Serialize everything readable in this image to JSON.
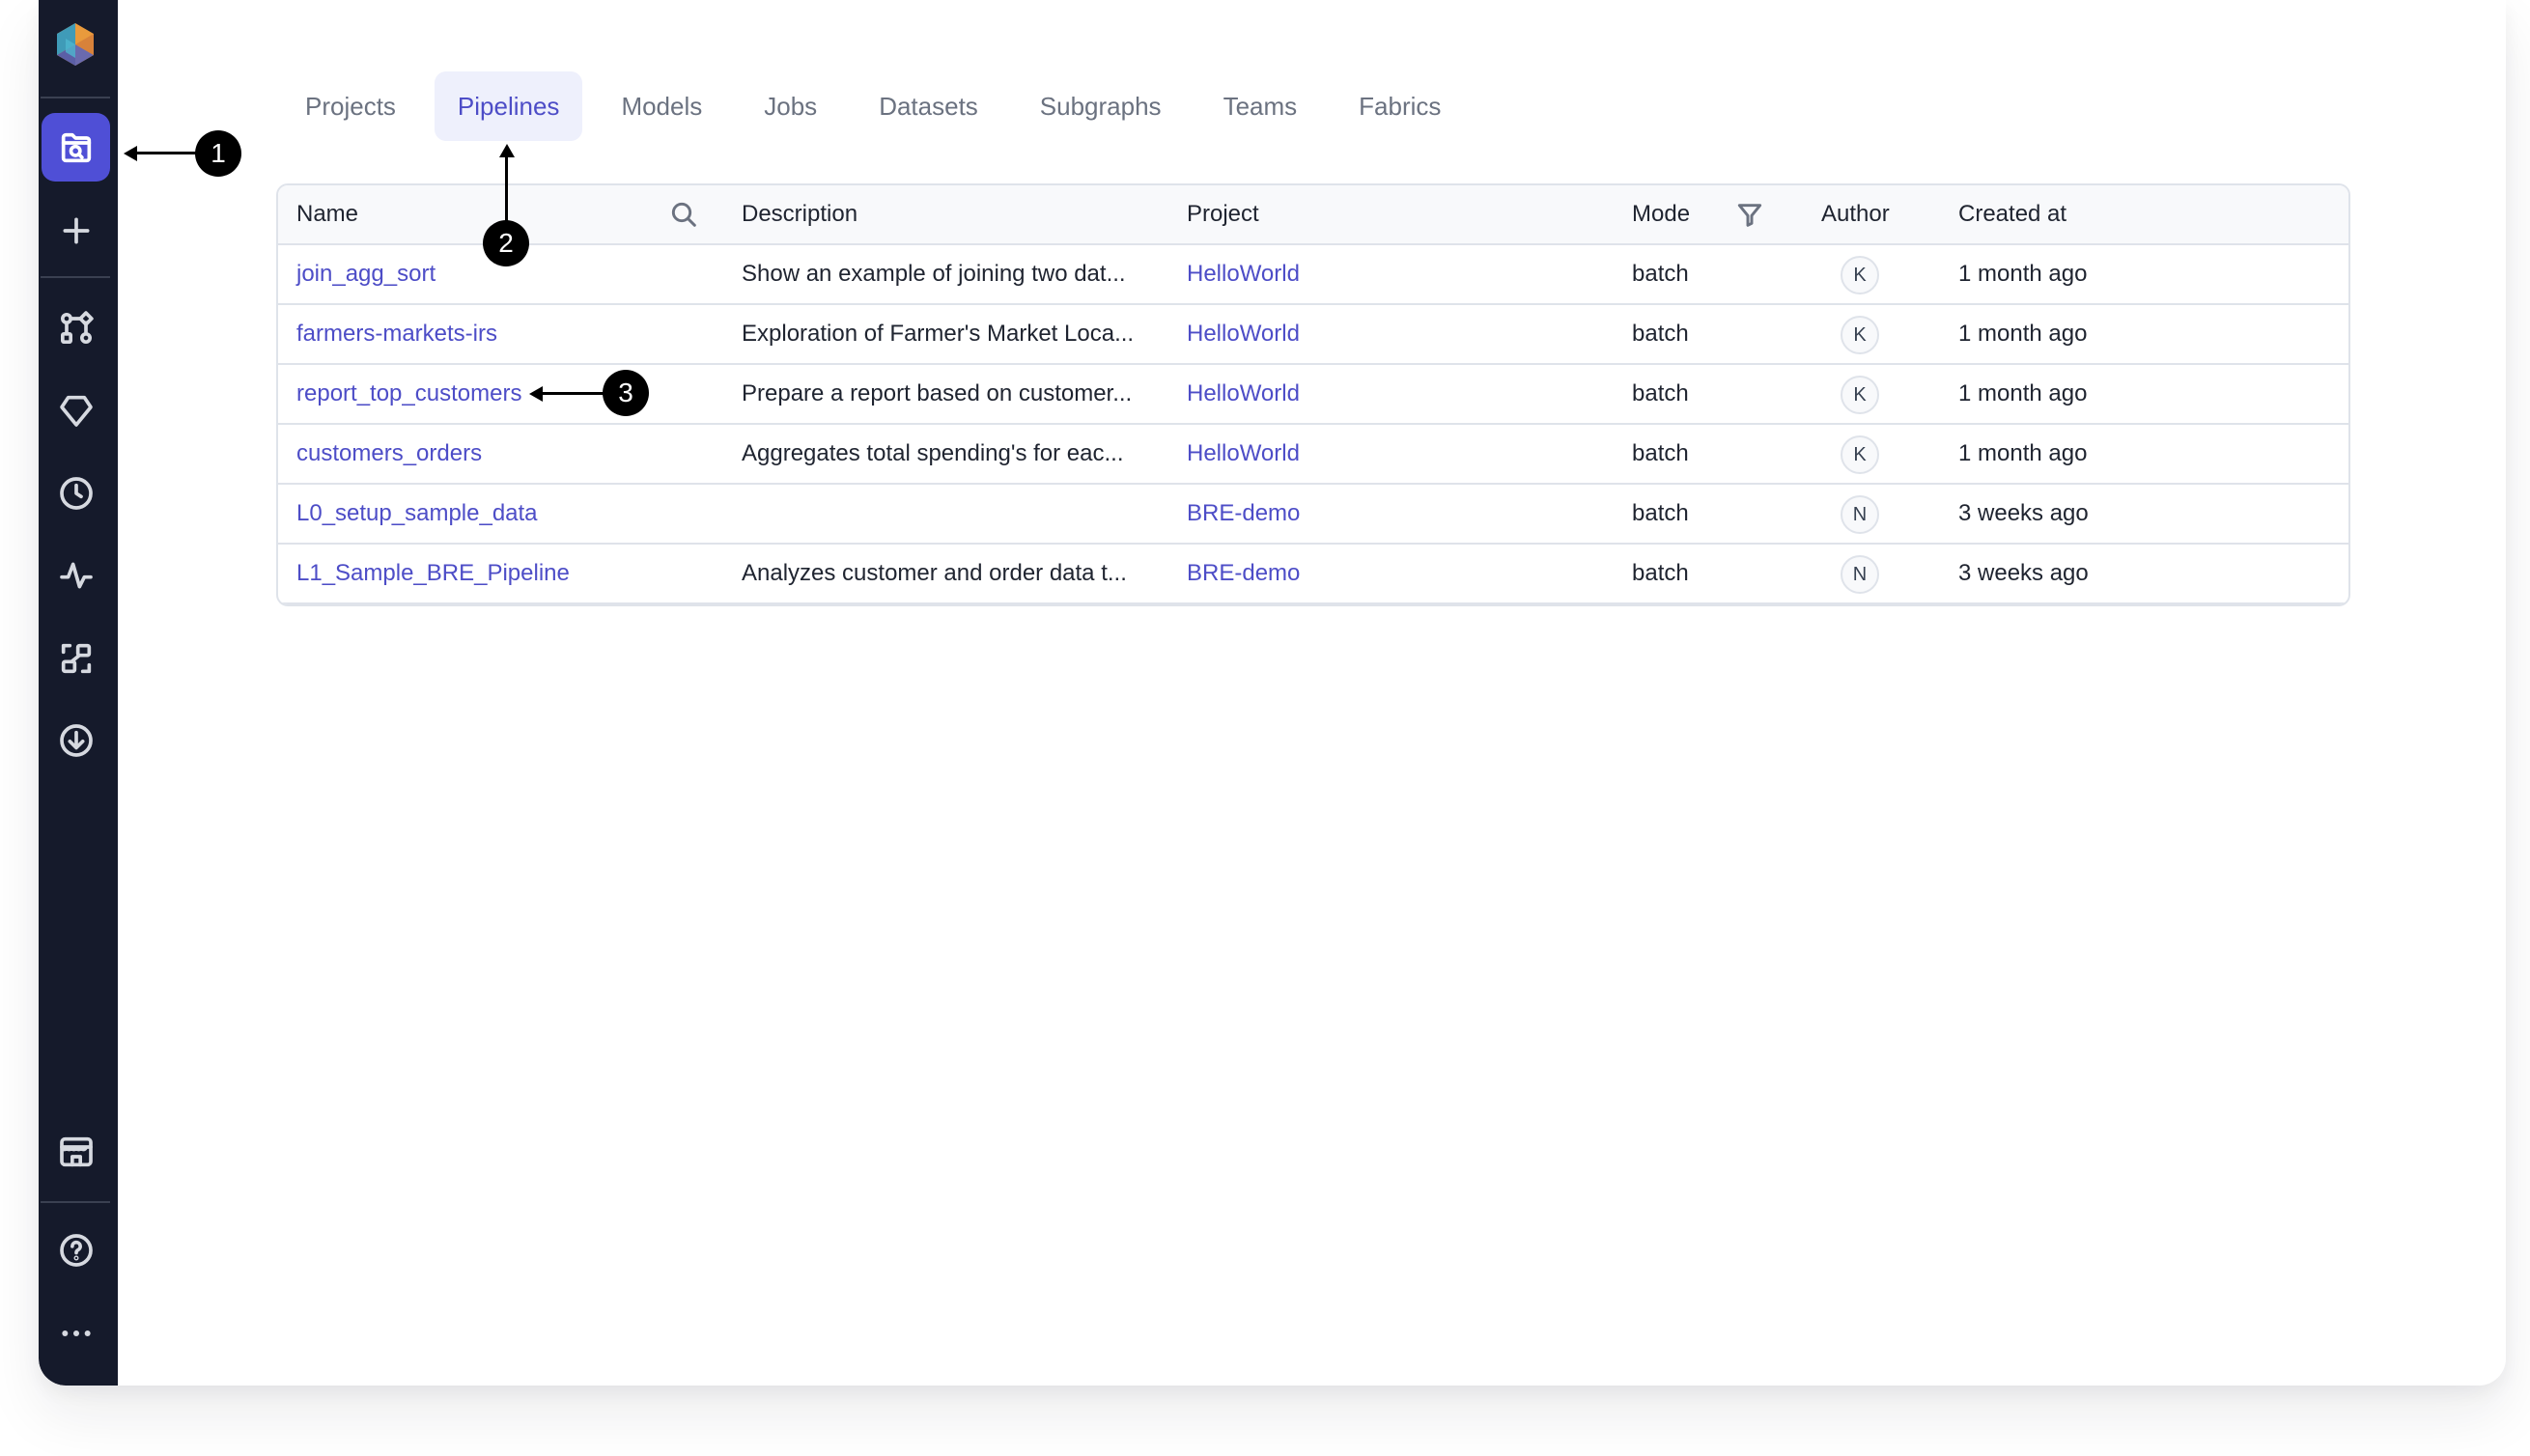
{
  "sidebar": {
    "items": [
      {
        "name": "entity-browser",
        "icon": "folder-search-icon",
        "active": true
      },
      {
        "name": "create",
        "icon": "plus-icon"
      },
      {
        "name": "pipelines",
        "icon": "graph-nodes-icon"
      },
      {
        "name": "gems",
        "icon": "diamond-icon"
      },
      {
        "name": "jobs",
        "icon": "clock-icon"
      },
      {
        "name": "observability",
        "icon": "pulse-icon"
      },
      {
        "name": "lineage",
        "icon": "lineage-icon"
      },
      {
        "name": "deploy",
        "icon": "download-circle-icon"
      },
      {
        "name": "marketplace",
        "icon": "store-icon"
      },
      {
        "name": "help",
        "icon": "help-circle-icon"
      },
      {
        "name": "more",
        "icon": "more-horizontal-icon"
      }
    ]
  },
  "tabs": [
    {
      "label": "Projects",
      "active": false
    },
    {
      "label": "Pipelines",
      "active": true
    },
    {
      "label": "Models",
      "active": false
    },
    {
      "label": "Jobs",
      "active": false
    },
    {
      "label": "Datasets",
      "active": false
    },
    {
      "label": "Subgraphs",
      "active": false
    },
    {
      "label": "Teams",
      "active": false
    },
    {
      "label": "Fabrics",
      "active": false
    }
  ],
  "table": {
    "columns": {
      "name": "Name",
      "description": "Description",
      "project": "Project",
      "mode": "Mode",
      "author": "Author",
      "created_at": "Created at"
    },
    "rows": [
      {
        "name": "join_agg_sort",
        "description": "Show an example of joining two dat...",
        "project": "HelloWorld",
        "mode": "batch",
        "author": "K",
        "created_at": "1 month ago"
      },
      {
        "name": "farmers-markets-irs",
        "description": "Exploration of Farmer's Market Loca...",
        "project": "HelloWorld",
        "mode": "batch",
        "author": "K",
        "created_at": "1 month ago"
      },
      {
        "name": "report_top_customers",
        "description": "Prepare a report based on customer...",
        "project": "HelloWorld",
        "mode": "batch",
        "author": "K",
        "created_at": "1 month ago"
      },
      {
        "name": "customers_orders",
        "description": "Aggregates total spending's for eac...",
        "project": "HelloWorld",
        "mode": "batch",
        "author": "K",
        "created_at": "1 month ago"
      },
      {
        "name": "L0_setup_sample_data",
        "description": "",
        "project": "BRE-demo",
        "mode": "batch",
        "author": "N",
        "created_at": "3 weeks ago"
      },
      {
        "name": "L1_Sample_BRE_Pipeline",
        "description": "Analyzes customer and order data t...",
        "project": "BRE-demo",
        "mode": "batch",
        "author": "N",
        "created_at": "3 weeks ago"
      }
    ]
  },
  "callouts": [
    "1",
    "2",
    "3"
  ],
  "colors": {
    "sidebar_bg": "#151a2b",
    "accent": "#4f4fd6",
    "link": "#4d4dc7",
    "active_tab_bg": "#eef0fc"
  }
}
